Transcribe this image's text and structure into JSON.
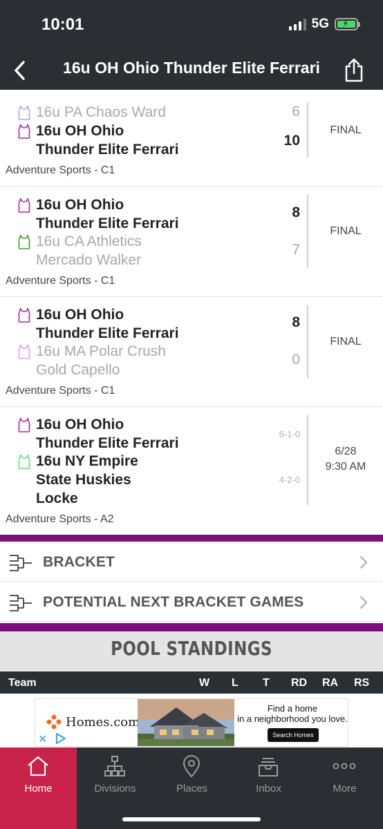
{
  "status_bar": {
    "time": "10:01",
    "network": "5G"
  },
  "nav": {
    "title": "16u OH Ohio Thunder Elite Ferrari"
  },
  "colors": {
    "header_bg": "#2b2f33",
    "accent_purple": "#7a0f7c",
    "active_tab": "#c8224b"
  },
  "games": [
    {
      "team1": {
        "name_line1": "16u PA Chaos Ward",
        "name_line2": "",
        "score": "6",
        "shirt_color": "#a9a6ef",
        "dim": true
      },
      "team2": {
        "name_line1": "16u OH Ohio",
        "name_line2": "Thunder Elite Ferrari",
        "score": "10",
        "shirt_color": "#a62aa4",
        "dim": false
      },
      "status": "FINAL",
      "venue": "Adventure Sports - C1"
    },
    {
      "team1": {
        "name_line1": "16u OH Ohio",
        "name_line2": "Thunder Elite Ferrari",
        "score": "8",
        "shirt_color": "#a62aa4",
        "dim": false
      },
      "team2": {
        "name_line1": "16u CA Athletics",
        "name_line2": "Mercado Walker",
        "score": "7",
        "shirt_color": "#3c9b2e",
        "dim": true
      },
      "status": "FINAL",
      "venue": "Adventure Sports - C1"
    },
    {
      "team1": {
        "name_line1": "16u OH Ohio",
        "name_line2": "Thunder Elite Ferrari",
        "score": "8",
        "shirt_color": "#a62aa4",
        "dim": false
      },
      "team2": {
        "name_line1": "16u MA Polar Crush",
        "name_line2": "Gold Capello",
        "score": "0",
        "shirt_color": "#e79be6",
        "dim": true
      },
      "status": "FINAL",
      "venue": "Adventure Sports - C1"
    },
    {
      "team1": {
        "name_line1": "16u OH Ohio",
        "name_line2": "Thunder Elite Ferrari",
        "record": "6-1-0",
        "shirt_color": "#a62aa4"
      },
      "team2": {
        "name_line1": "16u NY Empire",
        "name_line2": "State Huskies",
        "name_line3": "Locke",
        "record": "4-2-0",
        "shirt_color": "#5fe07c"
      },
      "date": "6/28",
      "time": "9:30 AM",
      "venue": "Adventure Sports - A2"
    }
  ],
  "menu": {
    "bracket": "BRACKET",
    "potential": "POTENTIAL NEXT BRACKET GAMES"
  },
  "standings": {
    "title": "POOL STANDINGS",
    "headers": [
      "Team",
      "W",
      "L",
      "T",
      "RD",
      "RA",
      "RS"
    ]
  },
  "ad": {
    "brand": "Homes.com",
    "copy_line1": "Find a home",
    "copy_line2": "in a neighborhood you love.",
    "button": "Search Homes"
  },
  "tabs": [
    {
      "label": "Home",
      "icon": "home-icon"
    },
    {
      "label": "Divisions",
      "icon": "divisions-icon"
    },
    {
      "label": "Places",
      "icon": "location-pin-icon"
    },
    {
      "label": "Inbox",
      "icon": "inbox-icon"
    },
    {
      "label": "More",
      "icon": "more-dots-icon"
    }
  ]
}
